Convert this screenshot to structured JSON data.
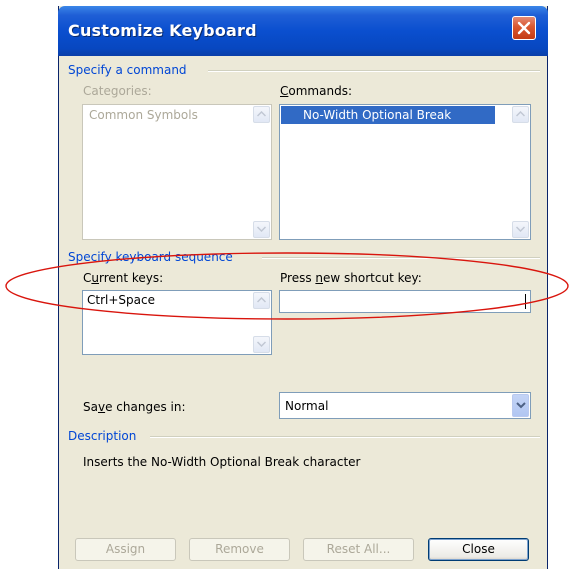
{
  "window": {
    "title": "Customize Keyboard"
  },
  "specify_command": {
    "group_label": "Specify a command",
    "categories": {
      "label_prefix": "Categories:",
      "items": [
        "Common Symbols"
      ]
    },
    "commands": {
      "label_pre": "",
      "label_mnemonic": "C",
      "label_post": "ommands:",
      "selected_item": "No-Width Optional Break"
    }
  },
  "keyboard_sequence": {
    "group_label": "Specify keyboard sequence",
    "current_keys": {
      "label_pre": "C",
      "label_mnemonic": "u",
      "label_post": "rrent keys:",
      "items": [
        "Ctrl+Space"
      ]
    },
    "new_shortcut": {
      "label_pre": "Press ",
      "label_mnemonic": "n",
      "label_post": "ew shortcut key:",
      "value": ""
    }
  },
  "save_changes": {
    "label_pre": "Sa",
    "label_mnemonic": "v",
    "label_post": "e changes in:",
    "selected": "Normal"
  },
  "description": {
    "group_label": "Description",
    "text": "Inserts the No-Width Optional Break character"
  },
  "buttons": {
    "assign": "Assign",
    "remove": "Remove",
    "reset_all": "Reset All...",
    "close": "Close"
  },
  "colors": {
    "title_bar": "#0a4fcf",
    "group_caption": "#0046d5",
    "selection": "#316ac5",
    "highlight_ellipse": "#d9150d"
  },
  "icons": {
    "close": "close-icon",
    "scroll_up": "scroll-up-arrow-icon",
    "scroll_down": "scroll-down-arrow-icon",
    "dropdown": "chevron-down-icon"
  }
}
